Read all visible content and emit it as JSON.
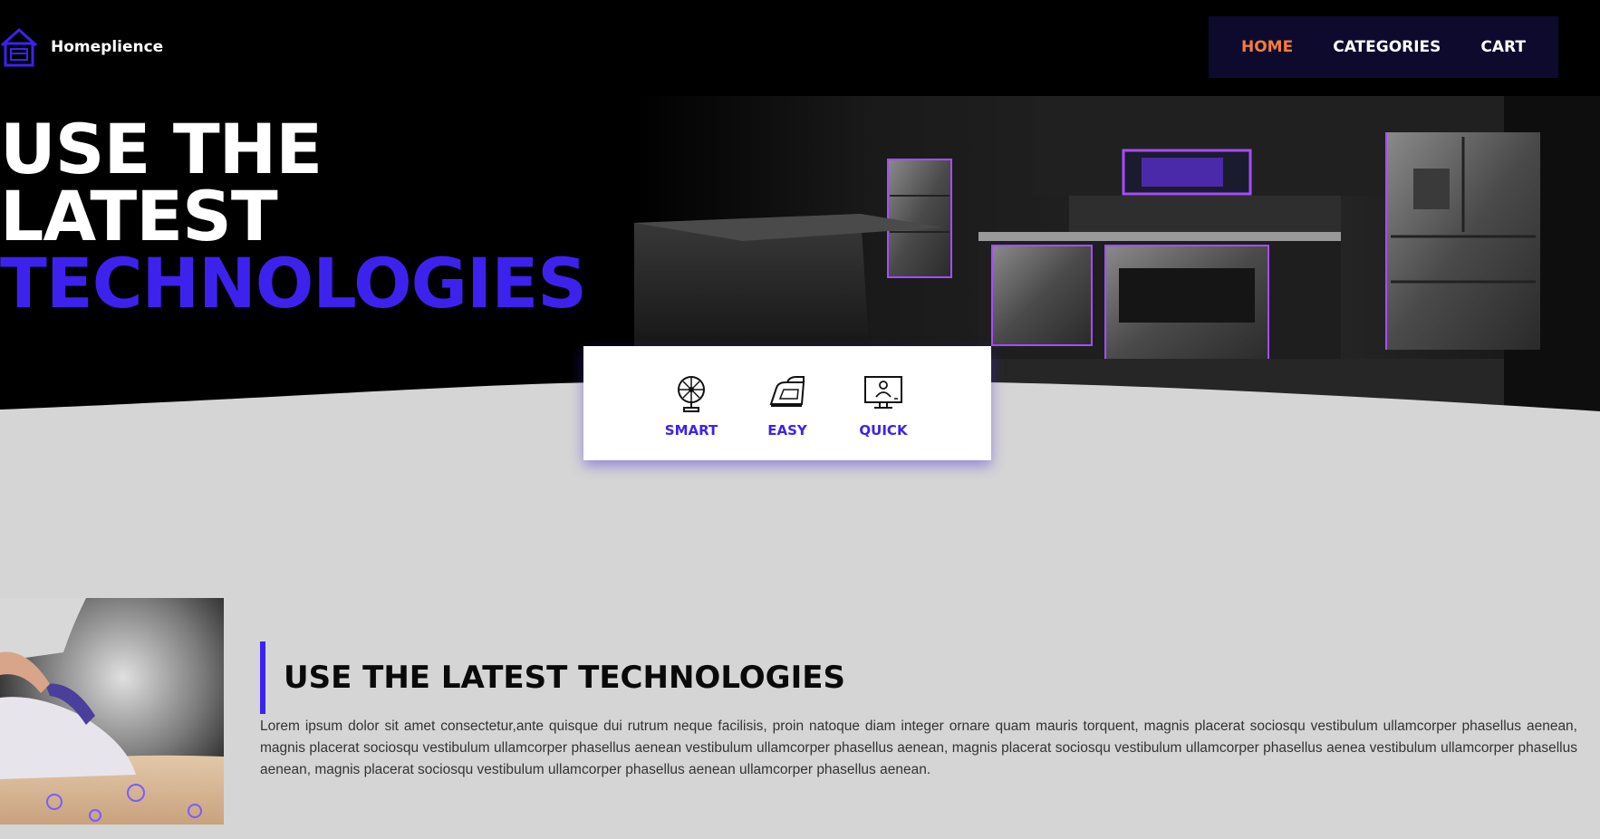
{
  "header": {
    "logo_text": "Homeplience",
    "logo_icon": "house-icon",
    "nav": [
      {
        "label": "HOME",
        "active": true
      },
      {
        "label": "CATEGORIES",
        "active": false
      },
      {
        "label": "CART",
        "active": false
      }
    ]
  },
  "hero": {
    "line1": "USE THE",
    "line2": "LATEST",
    "line3": "TECHNOLOGIES",
    "features": [
      {
        "label": "SMART",
        "icon": "fan-icon"
      },
      {
        "label": "EASY",
        "icon": "iron-icon"
      },
      {
        "label": "QUICK",
        "icon": "monitor-user-icon"
      }
    ]
  },
  "section": {
    "title": "USE THE LATEST TECHNOLOGIES",
    "text": "Lorem ipsum dolor sit amet consectetur,ante quisque dui rutrum neque facilisis, proin natoque diam integer ornare quam mauris torquent, magnis placerat sociosqu vestibulum ullamcorper phasellus aenean, magnis placerat sociosqu vestibulum ullamcorper phasellus aenean vestibulum ullamcorper phasellus aenean, magnis placerat sociosqu vestibulum ullamcorper phasellus aenea vestibulum ullamcorper phasellus aenean, magnis placerat sociosqu vestibulum ullamcorper phasellus aenean ullamcorper phasellus aenean."
  },
  "colors": {
    "accent": "#3d22ee",
    "nav_active": "#f47c3c",
    "nav_bg": "#0d0a2e",
    "page_bg": "#d5d5d5"
  }
}
